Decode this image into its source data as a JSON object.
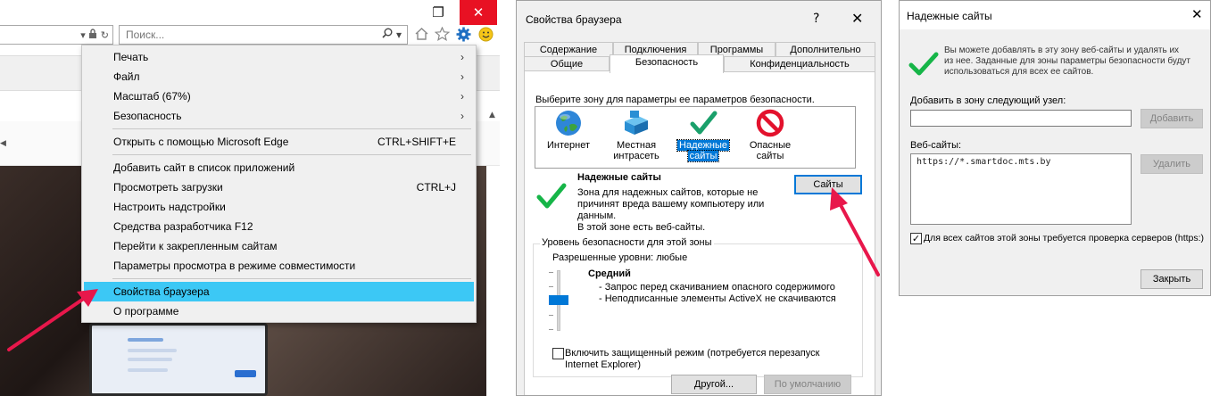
{
  "browser": {
    "search_placeholder": "Поиск...",
    "icons": [
      "dropdown-icon",
      "lock-icon",
      "refresh-icon",
      "search-icon",
      "home-icon",
      "star-icon",
      "gear-icon",
      "smiley-icon"
    ],
    "window_controls": {
      "restore": "❐",
      "close": "✕"
    },
    "menu": {
      "items": [
        {
          "label": "Печать",
          "shortcut": "",
          "submenu": true
        },
        {
          "label": "Файл",
          "shortcut": "",
          "submenu": true
        },
        {
          "label": "Масштаб (67%)",
          "shortcut": "",
          "submenu": true
        },
        {
          "label": "Безопасность",
          "shortcut": "",
          "submenu": true
        },
        {
          "label": "Открыть с помощью Microsoft Edge",
          "shortcut": "CTRL+SHIFT+E",
          "submenu": false
        },
        {
          "label": "Добавить сайт в список приложений",
          "shortcut": "",
          "submenu": false
        },
        {
          "label": "Просмотреть загрузки",
          "shortcut": "CTRL+J",
          "submenu": false
        },
        {
          "label": "Настроить надстройки",
          "shortcut": "",
          "submenu": false
        },
        {
          "label": "Средства разработчика F12",
          "shortcut": "",
          "submenu": false
        },
        {
          "label": "Перейти к закрепленным сайтам",
          "shortcut": "",
          "submenu": false
        },
        {
          "label": "Параметры просмотра в режиме совместимости",
          "shortcut": "",
          "submenu": false
        },
        {
          "label": "Свойства браузера",
          "shortcut": "",
          "submenu": false,
          "highlighted": true
        },
        {
          "label": "О программе",
          "shortcut": "",
          "submenu": false
        }
      ]
    }
  },
  "options_dialog": {
    "title": "Свойства браузера",
    "help": "?",
    "close": "✕",
    "tabs_row1": [
      "Содержание",
      "Подключения",
      "Программы",
      "Дополнительно"
    ],
    "tabs_row2": [
      "Общие",
      "Безопасность",
      "Конфиденциальность"
    ],
    "active_tab": "Безопасность",
    "zone_prompt": "Выберите зону для параметры ее параметров безопасности.",
    "zones": [
      {
        "label_line1": "Интернет",
        "label_line2": "",
        "icon": "globe-icon"
      },
      {
        "label_line1": "Местная",
        "label_line2": "интрасеть",
        "icon": "intranet-icon"
      },
      {
        "label_line1": "Надежные",
        "label_line2": "сайты",
        "icon": "checkmark-icon",
        "selected": true
      },
      {
        "label_line1": "Опасные",
        "label_line2": "сайты",
        "icon": "no-entry-icon"
      }
    ],
    "zone_title": "Надежные сайты",
    "zone_desc": [
      "Зона для надежных сайтов, которые не",
      "причинят вреда вашему компьютеру или",
      "данным.",
      "В этой зоне есть веб-сайты."
    ],
    "sites_button": "Сайты",
    "level_group_title": "Уровень безопасности для этой зоны",
    "allowed_levels": "Разрешенные уровни: любые",
    "level_name": "Средний",
    "level_bullets": [
      "- Запрос перед скачиванием опасного содержимого",
      "- Неподписанные элементы ActiveX не скачиваются"
    ],
    "protected_mode": [
      "Включить защищенный режим (потребуется перезапуск",
      "Internet Explorer)"
    ],
    "custom_button": "Другой...",
    "default_button": "По умолчанию"
  },
  "trusted_dialog": {
    "title": "Надежные сайты",
    "close": "✕",
    "info": [
      "Вы можете добавлять в эту зону  веб-сайты и удалять их",
      "из нее. Заданные для зоны параметры безопасности будут",
      "использоваться для всех ее сайтов."
    ],
    "add_label": "Добавить в зону следующий узел:",
    "add_value": "",
    "add_button": "Добавить",
    "sites_label": "Веб-сайты:",
    "sites": [
      "https://*.smartdoc.mts.by"
    ],
    "remove_button": "Удалить",
    "require_https": "Для всех сайтов этой зоны требуется проверка серверов (https:)",
    "require_https_checked": true,
    "close_button": "Закрыть"
  },
  "colors": {
    "menu_highlight": "#3cc8f5",
    "win_close": "#e81123",
    "arrow": "#e8174b",
    "accent": "#0078d7"
  }
}
